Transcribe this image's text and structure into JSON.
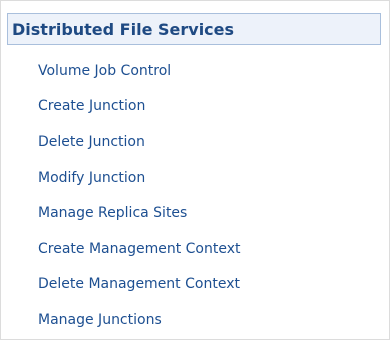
{
  "panel": {
    "header": "Distributed File Services",
    "items": [
      {
        "label": "Volume Job Control"
      },
      {
        "label": "Create Junction"
      },
      {
        "label": "Delete Junction"
      },
      {
        "label": "Modify Junction"
      },
      {
        "label": "Manage Replica Sites"
      },
      {
        "label": "Create Management Context"
      },
      {
        "label": "Delete Management Context"
      },
      {
        "label": "Manage Junctions"
      }
    ]
  },
  "colors": {
    "header_background": "#edf2fa",
    "header_border": "#a9bfdc",
    "header_text": "#1f4a83",
    "link_text": "#1d4f91"
  }
}
